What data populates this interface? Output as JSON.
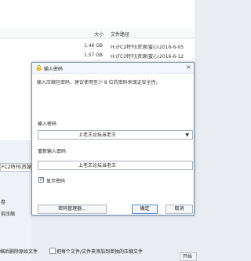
{
  "background": {
    "columns": {
      "size": "大小",
      "path": "文件路径"
    },
    "files": [
      {
        "size": "1.46 GB",
        "path": "H:\\FC2特刊\\资源\\蜜心\\2016-6-05"
      },
      {
        "size": "1.57 GB",
        "path": "H:\\FC2特刊\\资源\\蜜心\\2016-6-12"
      }
    ],
    "archive_name_partial": "FC2特刊\\资源\\",
    "side_labels": [
      "卷",
      "拆压缩"
    ],
    "delete_after_label": "缩后删除原始文件",
    "separate_archive_label": "把每个文件/文件夹添加到单独的压缩文件",
    "start_label": "开始"
  },
  "dialog": {
    "title": "输入密码",
    "info": "输入压缩包密码，建议使用至少 8 位的密码来保证安全性。",
    "password_label": "输入密码",
    "password_value": "上老王论坛当老王",
    "confirm_label": "重新输入密码",
    "confirm_value": "上老王论坛当老王",
    "show_password_label": "显示密码",
    "show_password_checked": true,
    "manager_button": "密码管理器...",
    "ok_button": "确定",
    "cancel_button": "取消"
  }
}
